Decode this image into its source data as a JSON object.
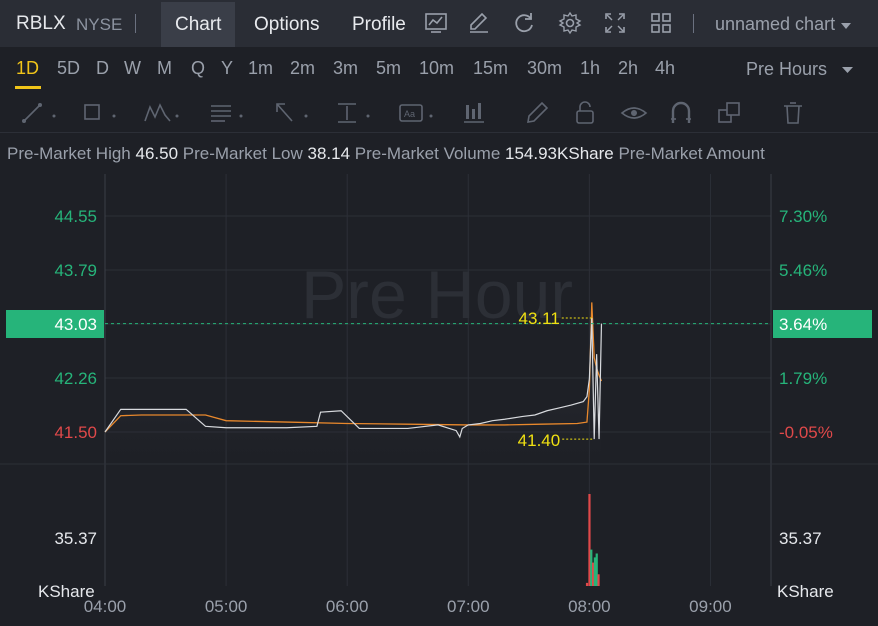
{
  "header": {
    "ticker": "RBLX",
    "exchange": "NYSE",
    "tabs": [
      {
        "label": "Chart",
        "active": true
      },
      {
        "label": "Options",
        "active": false
      },
      {
        "label": "Profile",
        "active": false
      }
    ],
    "icons": [
      "indicator-chart-icon",
      "draw-pen-icon",
      "refresh-icon",
      "settings-gear-icon",
      "fullscreen-icon",
      "layout-grid-icon"
    ],
    "chart_name": "unnamed chart"
  },
  "intervals": {
    "items": [
      "1D",
      "5D",
      "D",
      "W",
      "M",
      "Q",
      "Y",
      "1m",
      "2m",
      "3m",
      "5m",
      "10m",
      "15m",
      "30m",
      "1h",
      "2h",
      "4h"
    ],
    "active": "1D",
    "session_label": "Pre Hours"
  },
  "drawing_tools": [
    "trend-line-icon",
    "rectangle-icon",
    "wave-pattern-icon",
    "text-note-icon",
    "arrow-icon",
    "price-range-icon",
    "annotation-icon",
    "bar-pattern-icon",
    "pencil-icon",
    "lock-icon",
    "eye-icon",
    "magnet-icon",
    "layers-icon",
    "trash-icon"
  ],
  "stats": {
    "high_label": "Pre-Market High",
    "high_value": "46.50",
    "low_label": "Pre-Market Low",
    "low_value": "38.14",
    "volume_label": "Pre-Market Volume",
    "volume_value": "154.93KShare",
    "amount_label": "Pre-Market Amount"
  },
  "colors": {
    "up": "#26b47a",
    "down": "#e0494a",
    "price_line": "#d8dade",
    "avg_line": "#e8882c",
    "marker": "#f0e012",
    "current_tag": "#26b47a"
  },
  "chart_data": {
    "type": "line",
    "watermark": "Pre Hour",
    "x_ticks": [
      "04:00",
      "05:00",
      "06:00",
      "07:00",
      "08:00",
      "09:00"
    ],
    "x_range_hours": [
      4.0,
      9.5
    ],
    "y_ticks_left": [
      "44.55",
      "43.79",
      "43.03",
      "42.26",
      "41.50"
    ],
    "y_ticks_right": [
      "7.30%",
      "5.46%",
      "3.64%",
      "1.79%",
      "-0.05%"
    ],
    "y_range": [
      41.5,
      44.55
    ],
    "current_price": "43.03",
    "current_change": "3.64%",
    "high_marker": "43.11",
    "low_marker": "41.40",
    "volume_axis_label": "35.37",
    "volume_unit": "KShare",
    "series": [
      {
        "name": "price",
        "x": [
          4.0,
          4.13,
          4.3,
          4.5,
          4.67,
          4.83,
          5.0,
          5.25,
          5.5,
          5.75,
          5.78,
          5.95,
          6.1,
          6.25,
          6.5,
          6.75,
          6.9,
          6.93,
          6.95,
          7.0,
          7.1,
          7.2,
          7.3,
          7.45,
          7.55,
          7.65,
          7.75,
          7.85,
          7.95,
          7.98,
          8.0,
          8.02,
          8.04,
          8.06,
          8.08,
          8.1
        ],
        "y": [
          41.5,
          41.82,
          41.82,
          41.82,
          41.82,
          41.58,
          41.56,
          41.56,
          41.56,
          41.58,
          41.78,
          41.8,
          41.55,
          41.55,
          41.55,
          41.6,
          41.52,
          41.43,
          41.55,
          41.6,
          41.62,
          41.66,
          41.68,
          41.72,
          41.74,
          41.8,
          41.84,
          41.88,
          41.93,
          42.0,
          42.25,
          43.11,
          41.4,
          42.6,
          41.4,
          43.03
        ]
      },
      {
        "name": "average",
        "x": [
          4.0,
          4.13,
          4.3,
          4.83,
          5.0,
          5.5,
          6.0,
          6.5,
          7.0,
          7.3,
          7.6,
          7.9,
          7.98,
          8.0,
          8.02,
          8.04,
          8.06,
          8.08,
          8.1
        ],
        "y": [
          41.5,
          41.73,
          41.74,
          41.74,
          41.66,
          41.64,
          41.62,
          41.61,
          41.6,
          41.6,
          41.61,
          41.62,
          41.64,
          42.1,
          43.33,
          42.55,
          42.4,
          42.3,
          42.22
        ]
      }
    ],
    "volume": [
      {
        "x": 7.98,
        "v": 1.2,
        "dir": "down"
      },
      {
        "x": 8.0,
        "v": 35.37,
        "dir": "down"
      },
      {
        "x": 8.015,
        "v": 14.0,
        "dir": "up"
      },
      {
        "x": 8.03,
        "v": 9.0,
        "dir": "down"
      },
      {
        "x": 8.045,
        "v": 11.0,
        "dir": "up"
      },
      {
        "x": 8.06,
        "v": 12.5,
        "dir": "up"
      },
      {
        "x": 8.075,
        "v": 4.5,
        "dir": "down"
      }
    ]
  }
}
